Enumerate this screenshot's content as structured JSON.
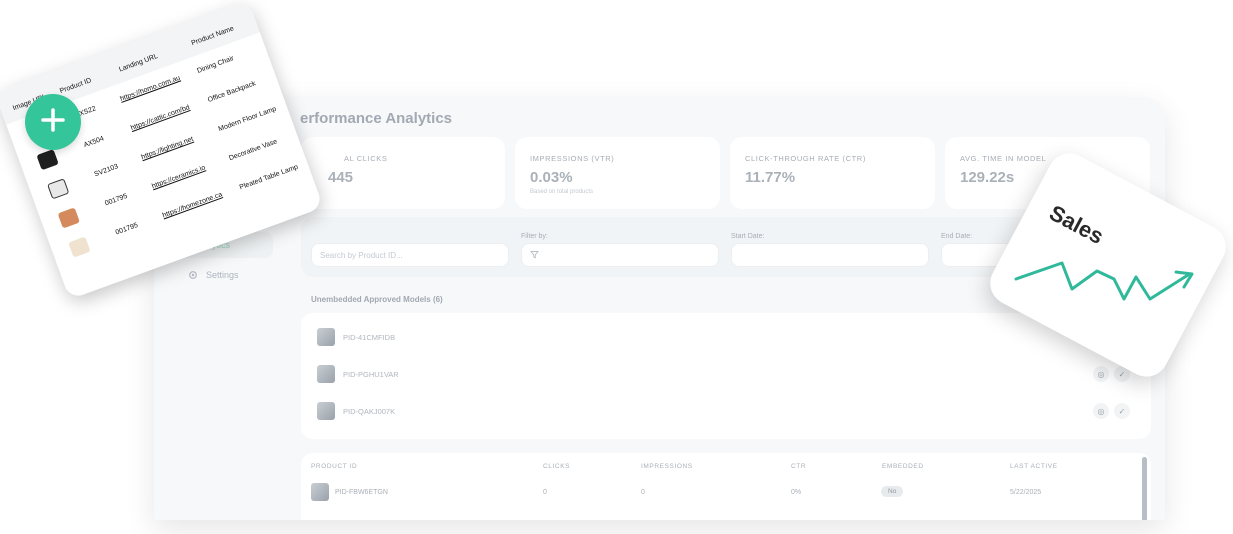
{
  "dashboard": {
    "title": "erformance Analytics",
    "sidebar": {
      "active_label": "ytics",
      "settings_label": "Settings"
    },
    "stats": [
      {
        "label": "AL CLICKS",
        "value": "445",
        "sub": ""
      },
      {
        "label": "IMPRESSIONS (VTR)",
        "value": "0.03%",
        "sub": "Based on total products"
      },
      {
        "label": "CLICK-THROUGH RATE (CTR)",
        "value": "11.77%",
        "sub": ""
      },
      {
        "label": "AVG. TIME IN MODEL",
        "value": "129.22s",
        "sub": ""
      }
    ],
    "filters": {
      "search_placeholder": "Search by Product ID...",
      "filter_label": "Filter by:",
      "start_label": "Start Date:",
      "end_label": "End Date:"
    },
    "models_section": {
      "title": "Unembedded Approved Models (6)",
      "rows": [
        "PID-41CMFIDB",
        "PID-PGHU1VAR",
        "PID-QAKJ007K"
      ]
    },
    "table": {
      "headers": [
        "PRODUCT ID",
        "CLICKS",
        "IMPRESSIONS",
        "CTR",
        "EMBEDDED",
        "LAST ACTIVE"
      ],
      "rows": [
        {
          "id": "PID-FBW6ETGN",
          "clicks": "0",
          "impressions": "0",
          "ctr": "0%",
          "embedded": "No",
          "last_active": "5/22/2025"
        }
      ]
    }
  },
  "product_table": {
    "headers": [
      "Image URL",
      "Product ID",
      "Landing URL",
      "Product Name"
    ],
    "rows": [
      {
        "id": "WXS22",
        "url": "https://homo.com.au",
        "name": "Dining Chair"
      },
      {
        "id": "AX504",
        "url": "https://cattic.com/bd",
        "name": "Office Backpack"
      },
      {
        "id": "SV2103",
        "url": "https://lighting.net",
        "name": "Modern Floor Lamp"
      },
      {
        "id": "001795",
        "url": "https://ceramics.io",
        "name": "Decorative Vase"
      },
      {
        "id": "001795",
        "url": "https://homezone.ca",
        "name": "Pleated Table Lamp"
      }
    ]
  },
  "sales_card": {
    "title": "Sales",
    "accent": "#2fb99a"
  },
  "plus_button": {
    "color": "#35c59a"
  }
}
